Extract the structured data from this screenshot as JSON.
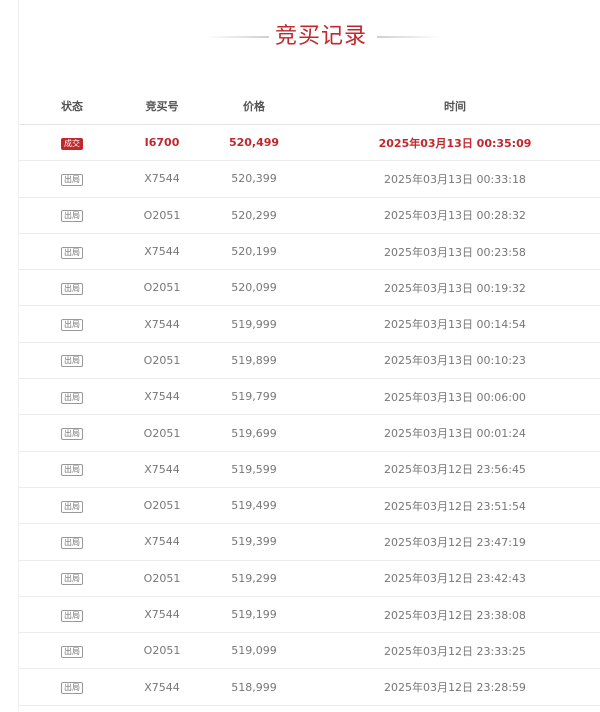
{
  "page": {
    "title": "竞买记录"
  },
  "table": {
    "headers": {
      "status": "状态",
      "bid_no": "竞买号",
      "price": "价格",
      "time": "时间"
    },
    "rows": [
      {
        "status": "成交",
        "bid_no": "I6700",
        "price": "520,499",
        "time": "2025年03月13日 00:35:09",
        "won": true
      },
      {
        "status": "出局",
        "bid_no": "X7544",
        "price": "520,399",
        "time": "2025年03月13日 00:33:18",
        "won": false
      },
      {
        "status": "出局",
        "bid_no": "O2051",
        "price": "520,299",
        "time": "2025年03月13日 00:28:32",
        "won": false
      },
      {
        "status": "出局",
        "bid_no": "X7544",
        "price": "520,199",
        "time": "2025年03月13日 00:23:58",
        "won": false
      },
      {
        "status": "出局",
        "bid_no": "O2051",
        "price": "520,099",
        "time": "2025年03月13日 00:19:32",
        "won": false
      },
      {
        "status": "出局",
        "bid_no": "X7544",
        "price": "519,999",
        "time": "2025年03月13日 00:14:54",
        "won": false
      },
      {
        "status": "出局",
        "bid_no": "O2051",
        "price": "519,899",
        "time": "2025年03月13日 00:10:23",
        "won": false
      },
      {
        "status": "出局",
        "bid_no": "X7544",
        "price": "519,799",
        "time": "2025年03月13日 00:06:00",
        "won": false
      },
      {
        "status": "出局",
        "bid_no": "O2051",
        "price": "519,699",
        "time": "2025年03月13日 00:01:24",
        "won": false
      },
      {
        "status": "出局",
        "bid_no": "X7544",
        "price": "519,599",
        "time": "2025年03月12日 23:56:45",
        "won": false
      },
      {
        "status": "出局",
        "bid_no": "O2051",
        "price": "519,499",
        "time": "2025年03月12日 23:51:54",
        "won": false
      },
      {
        "status": "出局",
        "bid_no": "X7544",
        "price": "519,399",
        "time": "2025年03月12日 23:47:19",
        "won": false
      },
      {
        "status": "出局",
        "bid_no": "O2051",
        "price": "519,299",
        "time": "2025年03月12日 23:42:43",
        "won": false
      },
      {
        "status": "出局",
        "bid_no": "X7544",
        "price": "519,199",
        "time": "2025年03月12日 23:38:08",
        "won": false
      },
      {
        "status": "出局",
        "bid_no": "O2051",
        "price": "519,099",
        "time": "2025年03月12日 23:33:25",
        "won": false
      },
      {
        "status": "出局",
        "bid_no": "X7544",
        "price": "518,999",
        "time": "2025年03月12日 23:28:59",
        "won": false
      }
    ]
  },
  "colors": {
    "accent": "#c1272d",
    "text": "#777777"
  }
}
